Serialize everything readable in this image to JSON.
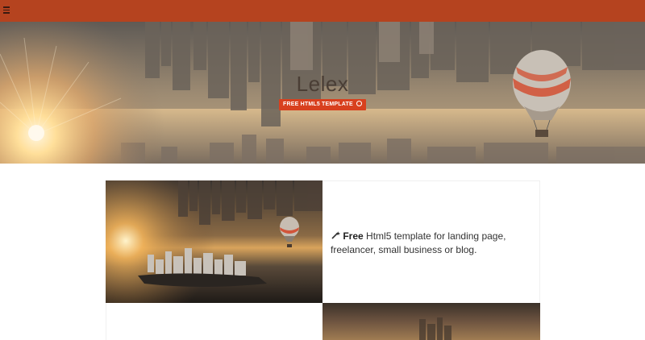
{
  "nav": {
    "menu_icon": "hamburger-menu-icon",
    "bar_color": "#b5431f"
  },
  "hero": {
    "title": "Lelex",
    "cta_label": "FREE HTML5 TEMPLATE",
    "cta_icon": "github-icon",
    "cta_color": "#d8401e"
  },
  "features": [
    {
      "image": "city-balloon-photo",
      "icon": "magic-wand-icon",
      "bold": "Free",
      "text": " Html5 template for landing page, freelancer, small business or blog."
    },
    {
      "image": "city-sunset-photo"
    }
  ]
}
